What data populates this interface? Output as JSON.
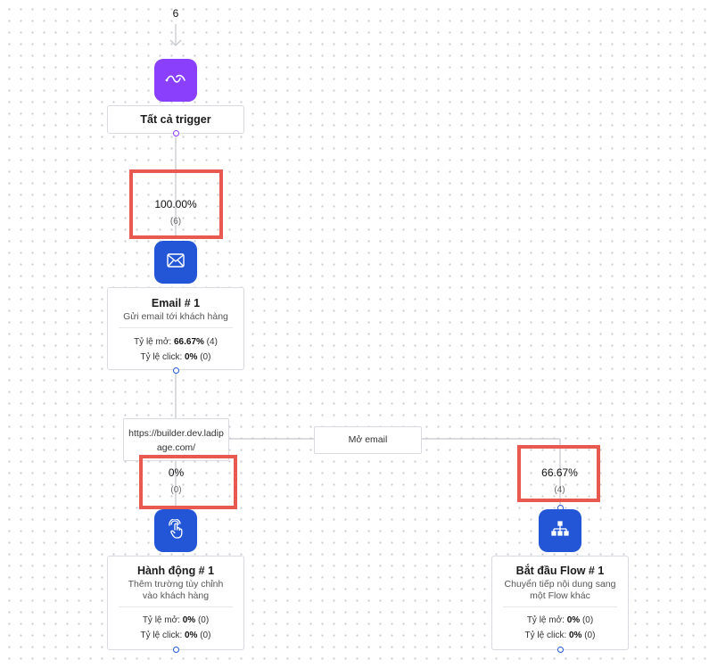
{
  "top_count": "6",
  "trigger": {
    "icon": "webhook-icon",
    "title": "Tất cả trigger",
    "color": "#8a3ffc"
  },
  "edge_trigger_email": {
    "percent": "100.00%",
    "count": "(6)"
  },
  "email": {
    "icon": "envelope-icon",
    "color": "#2356d6",
    "title": "Email # 1",
    "desc": "Gửi email tới khách hàng",
    "open_label": "Tỷ lệ mở: ",
    "open_value": "66.67%",
    "open_count": " (4)",
    "click_label": "Tỷ lệ click: ",
    "click_value": "0%",
    "click_count": " (0)"
  },
  "branch_left": {
    "label": "https://builder.dev.ladipage.com/",
    "percent": "0%",
    "count": "(0)"
  },
  "branch_right": {
    "label": "Mở email",
    "percent": "66.67%",
    "count": "(4)"
  },
  "action": {
    "icon": "touch-icon",
    "color": "#2356d6",
    "title": "Hành động # 1",
    "desc": "Thêm trường tùy chỉnh vào khách hàng",
    "open_label": "Tỷ lệ mở: ",
    "open_value": "0%",
    "open_count": " (0)",
    "click_label": "Tỷ lệ click: ",
    "click_value": "0%",
    "click_count": " (0)"
  },
  "flow": {
    "icon": "sitemap-icon",
    "color": "#2356d6",
    "title": "Bắt đầu Flow # 1",
    "desc": "Chuyển tiếp nội dung sang một Flow khác",
    "open_label": "Tỷ lệ mở: ",
    "open_value": "0%",
    "open_count": " (0)",
    "click_label": "Tỷ lệ click: ",
    "click_value": "0%",
    "click_count": " (0)"
  },
  "highlight_color": "#e85a4f"
}
